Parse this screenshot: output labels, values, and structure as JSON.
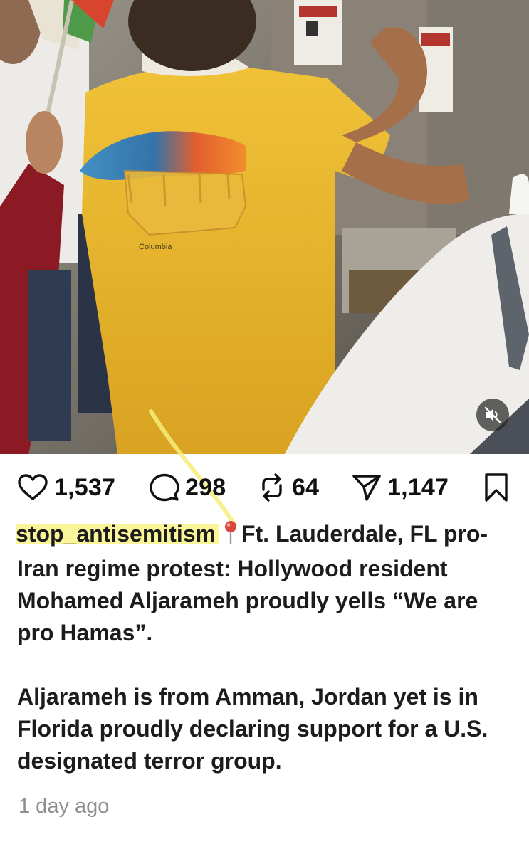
{
  "post": {
    "likes": "1,537",
    "comments": "298",
    "reposts": "64",
    "shares": "1,147",
    "username": "stop_antisemitism",
    "caption_line1_after_pin": "Ft. Lauderdale,",
    "caption_rest_p1": "FL pro-Iran regime protest: Hollywood resident Mohamed Aljarameh proudly yells “We are pro Hamas”.",
    "caption_p2": "Aljarameh is from Amman, Jordan yet is in Florida proudly declaring support for a U.S. designated terror group.",
    "time_ago": "1 day ago"
  },
  "media": {
    "shirt_brand": "Columbia",
    "mute_icon": "speaker-muted-icon"
  },
  "icons": {
    "like": "heart-icon",
    "comment": "comment-bubble-icon",
    "repost": "repost-arrows-icon",
    "share": "send-icon",
    "save": "bookmark-icon",
    "location": "location-pin-icon"
  },
  "colors": {
    "highlight": "#fbf59a",
    "shirt": "#e7b52c",
    "muted_text": "#8e8e8e",
    "pin_red": "#d9463b"
  }
}
